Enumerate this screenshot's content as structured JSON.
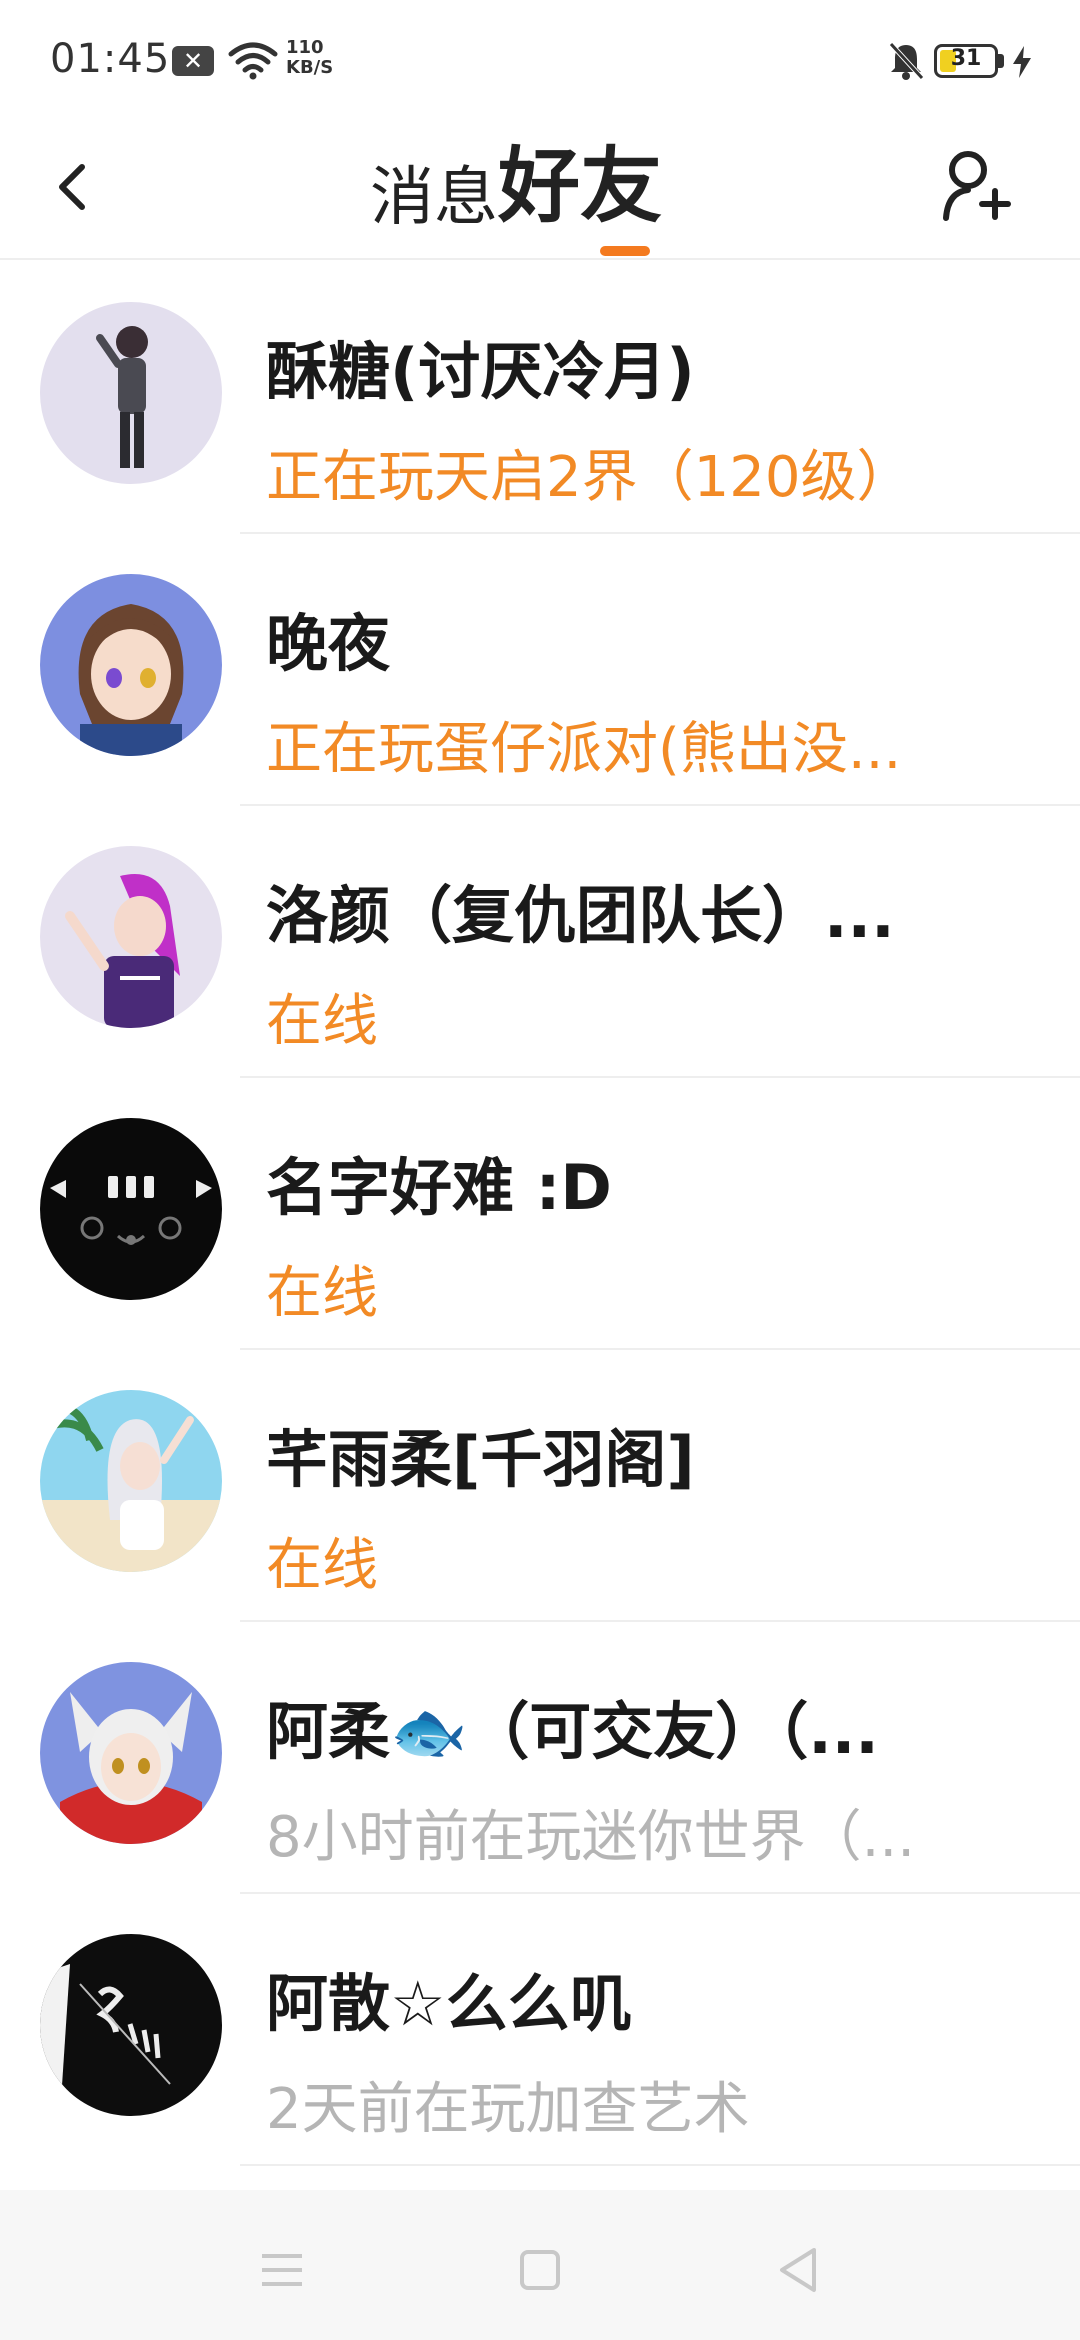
{
  "status_bar": {
    "time": "01:45",
    "speed_value": "110",
    "speed_unit": "KB/S",
    "battery": "31",
    "battery_level": 0.31
  },
  "header": {
    "tabs": [
      {
        "label": "消息"
      },
      {
        "label": "好友"
      }
    ],
    "active_tab": "好友",
    "accent_color": "#f47a1f"
  },
  "friends": [
    {
      "name": "酥糖(讨厌冷月)",
      "status": "正在玩天启2界（120级）",
      "status_type": "active"
    },
    {
      "name": "晚夜",
      "status": "正在玩蛋仔派对(熊出没...",
      "status_type": "active"
    },
    {
      "name": "洛颜（复仇团队长）...",
      "status": "在线",
      "status_type": "active"
    },
    {
      "name": "名字好难 :D",
      "status": "在线",
      "status_type": "active"
    },
    {
      "name": "芊雨柔[千羽阁]",
      "status": "在线",
      "status_type": "active"
    },
    {
      "name": "阿柔🐟（可交友）（...",
      "status": "8小时前在玩迷你世界（...",
      "status_type": "inactive"
    },
    {
      "name": "阿散☆么么叽",
      "status": "2天前在玩加查艺术",
      "status_type": "inactive"
    }
  ],
  "colors": {
    "active_status": "#f28a25",
    "inactive_status": "#b5b5b5"
  },
  "icons": {
    "back": "chevron-left-icon",
    "add_friend": "add-person-icon",
    "nav_menu": "menu-icon",
    "nav_home": "square-icon",
    "nav_back": "triangle-back-icon"
  }
}
